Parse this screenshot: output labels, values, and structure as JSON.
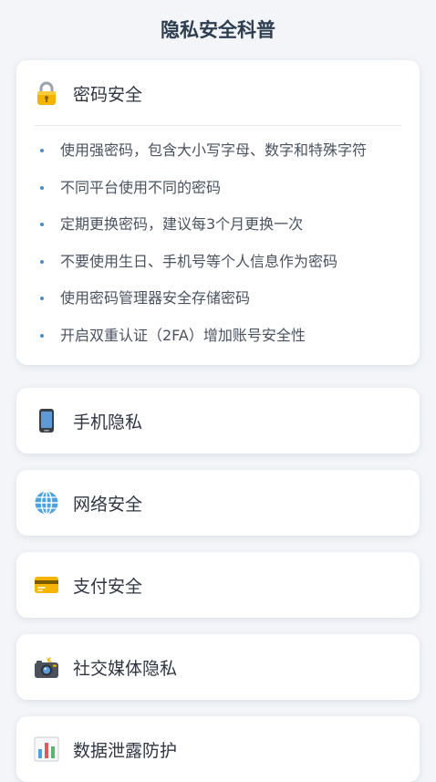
{
  "page": {
    "title": "隐私安全科普"
  },
  "sections": [
    {
      "title": "密码安全",
      "icon": "lock-icon",
      "expanded": true,
      "tips": [
        "使用强密码，包含大小写字母、数字和特殊字符",
        "不同平台使用不同的密码",
        "定期更换密码，建议每3个月更换一次",
        "不要使用生日、手机号等个人信息作为密码",
        "使用密码管理器安全存储密码",
        "开启双重认证（2FA）增加账号安全性"
      ]
    },
    {
      "title": "手机隐私",
      "icon": "mobile-phone-icon",
      "expanded": false
    },
    {
      "title": "网络安全",
      "icon": "globe-icon",
      "expanded": false
    },
    {
      "title": "支付安全",
      "icon": "credit-card-icon",
      "expanded": false
    },
    {
      "title": "社交媒体隐私",
      "icon": "camera-flash-icon",
      "expanded": false
    },
    {
      "title": "数据泄露防护",
      "icon": "bar-chart-icon",
      "expanded": false
    }
  ],
  "colors": {
    "background": "#f3f5f9",
    "card": "#ffffff",
    "title_text": "#2c3e50",
    "tip_text": "#4a5260",
    "bullet": "#4a8fc8"
  }
}
